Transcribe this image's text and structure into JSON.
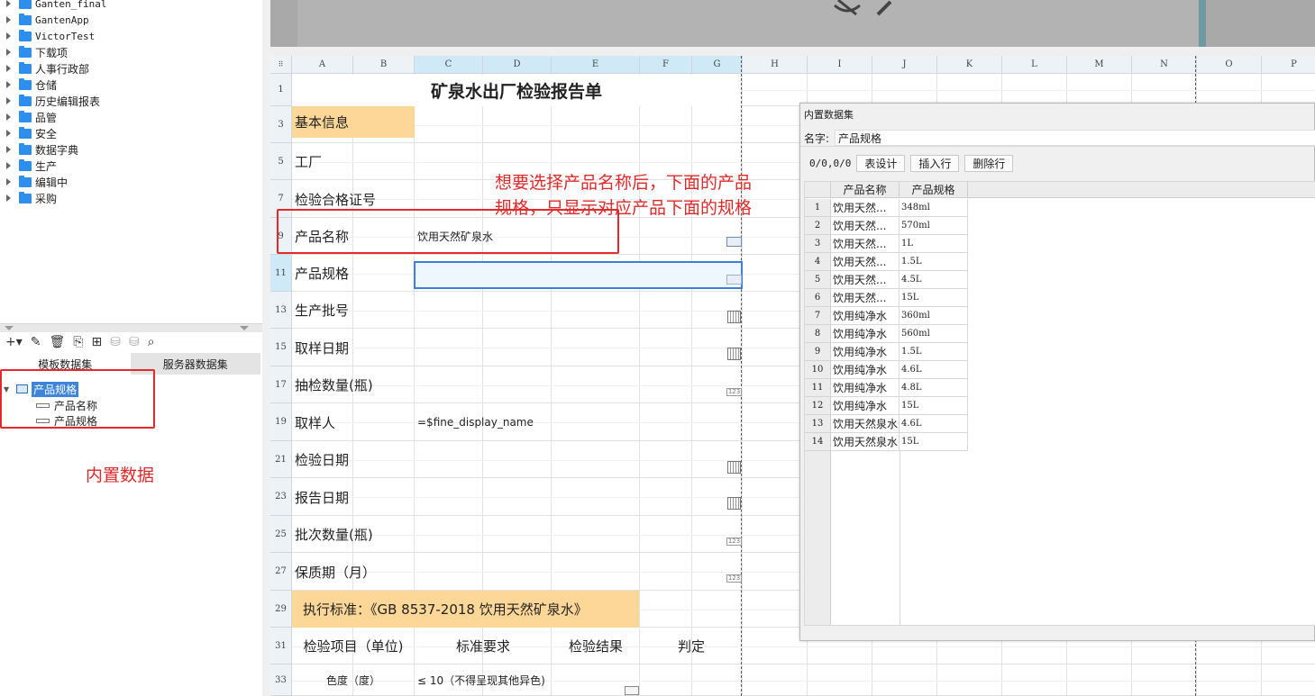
{
  "folders": [
    "Ganten_final",
    "GantenApp",
    "VictorTest",
    "下载项",
    "人事行政部",
    "仓储",
    "历史编辑报表",
    "品管",
    "安全",
    "数据字典",
    "生产",
    "编辑中",
    "采购"
  ],
  "dataset_panel": {
    "tabs": [
      "模板数据集",
      "服务器数据集"
    ],
    "dataset_name": "产品规格",
    "fields": [
      "产品名称",
      "产品规格"
    ]
  },
  "annotations": {
    "left_note": "内置数据",
    "right_note_line1": "想要选择产品名称后，下面的产品",
    "right_note_line2": "规格，只显示对应产品下面的规格"
  },
  "sheet": {
    "columns": [
      "A",
      "B",
      "C",
      "D",
      "E",
      "F",
      "G",
      "H",
      "I",
      "J",
      "K",
      "L",
      "M",
      "N",
      "O",
      "P"
    ],
    "rows": [
      "1",
      "3",
      "5",
      "7",
      "9",
      "11",
      "13",
      "15",
      "17",
      "19",
      "21",
      "23",
      "25",
      "27",
      "29",
      "31",
      "33"
    ],
    "title": "矿泉水出厂检验报告单",
    "basic_info": "基本信息",
    "labels": [
      "工厂",
      "检验合格证号",
      "产品名称",
      "产品规格",
      "生产批号",
      "取样日期",
      "抽检数量(瓶)",
      "取样人",
      "检验日期",
      "报告日期",
      "批次数量(瓶)",
      "保质期（月）"
    ],
    "product_name_value": "饮用天然矿泉水",
    "sampler_formula": "=$fine_display_name",
    "standard": "执行标准：《GB 8537-2018 饮用天然矿泉水》",
    "headers_row31": [
      "检验项目（单位)",
      "标准要求",
      "检验结果",
      "判定"
    ],
    "row33": [
      "色度（度）",
      "≤ 10（不得呈现其他异色)"
    ],
    "num_icon_text": "123"
  },
  "dialog": {
    "title": "内置数据集",
    "name_label": "名字:",
    "name_value": "产品规格",
    "counter": "0/0,0/0",
    "buttons": [
      "表设计",
      "插入行",
      "删除行"
    ],
    "columns": [
      "产品名称",
      "产品规格"
    ],
    "rows": [
      {
        "i": "1",
        "name": "饮用天然...",
        "spec": "348ml"
      },
      {
        "i": "2",
        "name": "饮用天然...",
        "spec": "570ml"
      },
      {
        "i": "3",
        "name": "饮用天然...",
        "spec": "1L"
      },
      {
        "i": "4",
        "name": "饮用天然...",
        "spec": "1.5L"
      },
      {
        "i": "5",
        "name": "饮用天然...",
        "spec": "4.5L"
      },
      {
        "i": "6",
        "name": "饮用天然...",
        "spec": "15L"
      },
      {
        "i": "7",
        "name": "饮用纯净水",
        "spec": "360ml"
      },
      {
        "i": "8",
        "name": "饮用纯净水",
        "spec": "560ml"
      },
      {
        "i": "9",
        "name": "饮用纯净水",
        "spec": "1.5L"
      },
      {
        "i": "10",
        "name": "饮用纯净水",
        "spec": "4.6L"
      },
      {
        "i": "11",
        "name": "饮用纯净水",
        "spec": "4.8L"
      },
      {
        "i": "12",
        "name": "饮用纯净水",
        "spec": "15L"
      },
      {
        "i": "13",
        "name": "饮用天然泉水",
        "spec": "4.6L"
      },
      {
        "i": "14",
        "name": "饮用天然泉水",
        "spec": "15L"
      }
    ]
  }
}
